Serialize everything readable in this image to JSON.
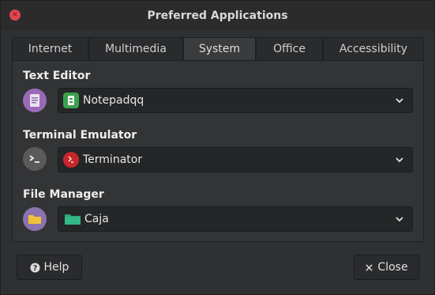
{
  "window": {
    "title": "Preferred Applications"
  },
  "tabs": [
    {
      "label": "Internet",
      "active": false
    },
    {
      "label": "Multimedia",
      "active": false
    },
    {
      "label": "System",
      "active": true
    },
    {
      "label": "Office",
      "active": false
    },
    {
      "label": "Accessibility",
      "active": false
    }
  ],
  "sections": [
    {
      "label": "Text Editor",
      "selected": "Notepadqq",
      "icon": "text-editor-icon"
    },
    {
      "label": "Terminal Emulator",
      "selected": "Terminator",
      "icon": "terminal-icon"
    },
    {
      "label": "File Manager",
      "selected": "Caja",
      "icon": "folder-icon"
    }
  ],
  "buttons": {
    "help": "Help",
    "close": "Close"
  },
  "colors": {
    "close_dot": "#e0454f",
    "text_editor_circle": "#9a6ab8",
    "terminal_circle": "#5a5a5a",
    "file_manager_circle": "#8a73b0",
    "notepadqq_icon": "#3aa14d",
    "terminator_icon": "#c8262b",
    "caja_icon": "#2aa57a"
  }
}
